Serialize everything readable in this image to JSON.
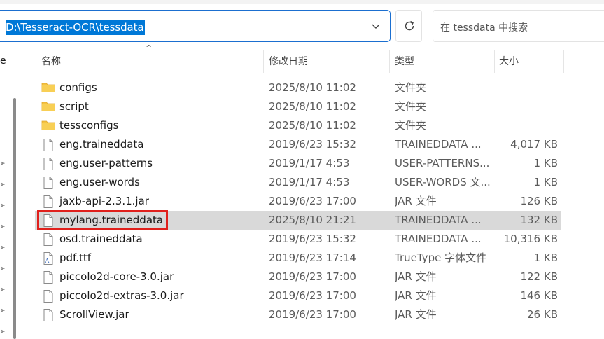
{
  "address_bar": {
    "path": "D:\\Tesseract-OCR\\tessdata"
  },
  "search": {
    "placeholder": "在 tessdata 中搜索"
  },
  "nav_pane": {
    "partial_label": "e"
  },
  "columns": {
    "name": "名称",
    "date": "修改日期",
    "type": "类型",
    "size": "大小"
  },
  "sort_indicator": "^",
  "files": [
    {
      "name": "configs",
      "date": "2025/8/10 11:02",
      "type": "文件夹",
      "size": "",
      "icon": "folder-icon"
    },
    {
      "name": "script",
      "date": "2025/8/10 11:02",
      "type": "文件夹",
      "size": "",
      "icon": "folder-icon"
    },
    {
      "name": "tessconfigs",
      "date": "2025/8/10 11:02",
      "type": "文件夹",
      "size": "",
      "icon": "folder-icon"
    },
    {
      "name": "eng.traineddata",
      "date": "2019/6/23 15:32",
      "type": "TRAINEDDATA ...",
      "size": "4,017 KB",
      "icon": "file-icon"
    },
    {
      "name": "eng.user-patterns",
      "date": "2019/1/17 4:53",
      "type": "USER-PATTERNS...",
      "size": "1 KB",
      "icon": "file-icon"
    },
    {
      "name": "eng.user-words",
      "date": "2019/1/17 4:53",
      "type": "USER-WORDS 文...",
      "size": "1 KB",
      "icon": "file-icon"
    },
    {
      "name": "jaxb-api-2.3.1.jar",
      "date": "2019/6/23 17:00",
      "type": "JAR 文件",
      "size": "126 KB",
      "icon": "file-icon"
    },
    {
      "name": "mylang.traineddata",
      "date": "2025/8/10 21:21",
      "type": "TRAINEDDATA ...",
      "size": "132 KB",
      "icon": "file-icon",
      "selected": true
    },
    {
      "name": "osd.traineddata",
      "date": "2019/6/23 15:32",
      "type": "TRAINEDDATA ...",
      "size": "10,316 KB",
      "icon": "file-icon"
    },
    {
      "name": "pdf.ttf",
      "date": "2019/6/23 17:14",
      "type": "TrueType 字体文件",
      "size": "1 KB",
      "icon": "font-file-icon"
    },
    {
      "name": "piccolo2d-core-3.0.jar",
      "date": "2019/6/23 17:00",
      "type": "JAR 文件",
      "size": "122 KB",
      "icon": "file-icon"
    },
    {
      "name": "piccolo2d-extras-3.0.jar",
      "date": "2019/6/23 17:00",
      "type": "JAR 文件",
      "size": "146 KB",
      "icon": "file-icon"
    },
    {
      "name": "ScrollView.jar",
      "date": "2019/6/23 17:00",
      "type": "JAR 文件",
      "size": "26 KB",
      "icon": "file-icon"
    }
  ],
  "colors": {
    "selection_bg": "#d9d9d9",
    "address_highlight": "#0078d7",
    "annotation_red": "#e0201c",
    "folder_yellow": "#f5c342"
  }
}
